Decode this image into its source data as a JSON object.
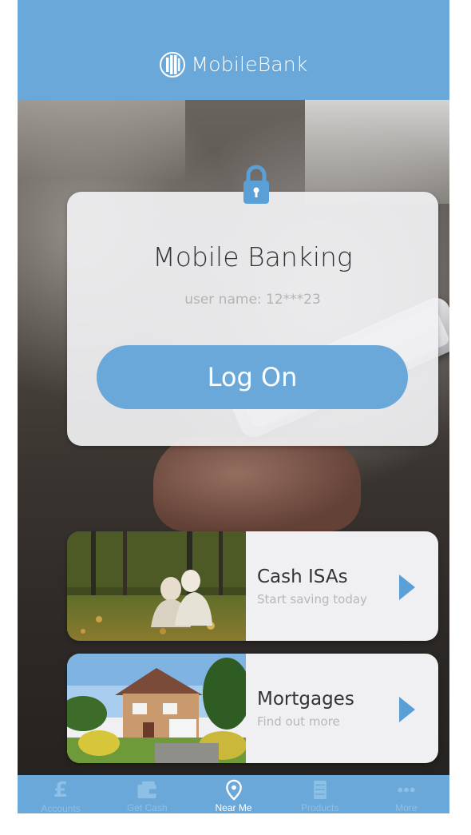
{
  "app": {
    "name": "MobileBank"
  },
  "login": {
    "title": "Mobile Banking",
    "username": "user name: 12***23",
    "button_label": "Log On"
  },
  "promos": [
    {
      "title": "Cash ISAs",
      "subtitle": "Start saving today",
      "image": "elderly-couple-photo"
    },
    {
      "title": "Mortgages",
      "subtitle": "Find out more",
      "image": "house-photo"
    }
  ],
  "tabs": [
    {
      "label": "Accounts",
      "icon": "pound-icon",
      "active": false
    },
    {
      "label": "Get Cash",
      "icon": "wallet-icon",
      "active": false
    },
    {
      "label": "Near Me",
      "icon": "location-pin-icon",
      "active": true
    },
    {
      "label": "Products",
      "icon": "cabinet-icon",
      "active": false
    },
    {
      "label": "More",
      "icon": "more-dots-icon",
      "active": false
    }
  ],
  "colors": {
    "brand": "#6aa8da",
    "tab_inactive": "#8ec0e6",
    "card": "#f0f0f2"
  }
}
